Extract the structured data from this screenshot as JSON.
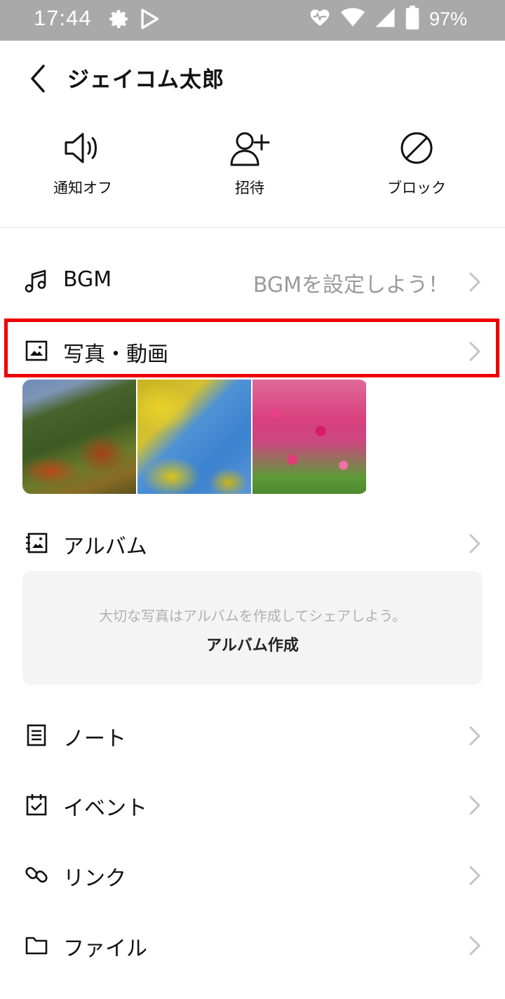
{
  "status_bar": {
    "time": "17:44",
    "battery_percent": "97%",
    "icons": [
      "gear-icon",
      "play-store-icon",
      "heartbeat-icon",
      "wifi-icon",
      "signal-icon",
      "battery-icon"
    ]
  },
  "header": {
    "title": "ジェイコム太郎",
    "back_icon": "chevron-left-icon"
  },
  "actions": [
    {
      "label": "通知オフ",
      "icon": "speaker-icon"
    },
    {
      "label": "招待",
      "icon": "add-person-icon"
    },
    {
      "label": "ブロック",
      "icon": "block-icon"
    }
  ],
  "menu": {
    "bgm": {
      "label": "BGM",
      "value": "BGMを設定しよう！",
      "icon": "music-note-icon"
    },
    "photos": {
      "label": "写真・動画",
      "icon": "image-icon",
      "thumbnails": [
        "autumn-mountain",
        "ginkgo-tree",
        "cosmos-field"
      ]
    },
    "album": {
      "label": "アルバム",
      "icon": "album-icon",
      "hint": "大切な写真はアルバムを作成してシェアしよう。",
      "create_label": "アルバム作成"
    },
    "note": {
      "label": "ノート",
      "icon": "note-icon"
    },
    "event": {
      "label": "イベント",
      "icon": "calendar-icon"
    },
    "link": {
      "label": "リンク",
      "icon": "link-icon"
    },
    "file": {
      "label": "ファイル",
      "icon": "folder-icon"
    }
  },
  "colors": {
    "highlight_border": "#f00000",
    "status_bar_bg": "#a9a9a9",
    "secondary_text": "#9a9a9a"
  }
}
